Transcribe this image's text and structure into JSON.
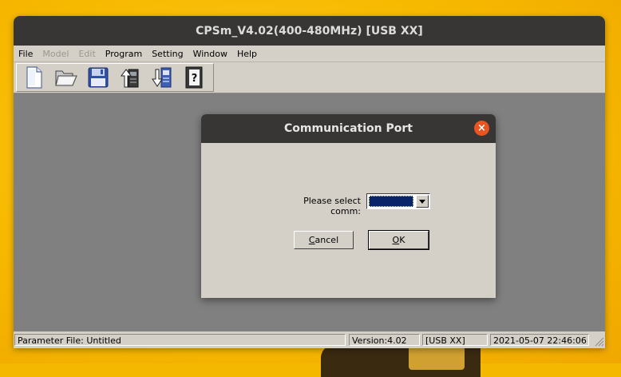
{
  "window": {
    "title": "CPSm_V4.02(400-480MHz) [USB XX]"
  },
  "menu": [
    {
      "label": "File",
      "enabled": true
    },
    {
      "label": "Model",
      "enabled": false
    },
    {
      "label": "Edit",
      "enabled": false
    },
    {
      "label": "Program",
      "enabled": true
    },
    {
      "label": "Setting",
      "enabled": true
    },
    {
      "label": "Window",
      "enabled": true
    },
    {
      "label": "Help",
      "enabled": true
    }
  ],
  "toolbar": {
    "buttons": [
      {
        "icon": "new-file-icon"
      },
      {
        "icon": "open-folder-icon"
      },
      {
        "icon": "save-disk-icon"
      },
      {
        "icon": "read-from-radio-icon"
      },
      {
        "icon": "write-to-radio-icon"
      },
      {
        "icon": "help-book-icon"
      }
    ]
  },
  "dialog": {
    "title": "Communication Port",
    "close_icon": "close-icon",
    "comm_label": "Please select comm:",
    "comm_value": "",
    "cancel_label": "Cancel",
    "ok_label": "OK"
  },
  "status": {
    "parameter_file": "Parameter File: Untitled",
    "version": "Version:4.02",
    "connection": "[USB XX]",
    "datetime": "2021-05-07 22:46:06"
  },
  "colors": {
    "title_bar": "#383634",
    "close_button": "#e95420",
    "selection": "#0a246a",
    "workspace": "#808080",
    "desktop": "#f5b800"
  }
}
